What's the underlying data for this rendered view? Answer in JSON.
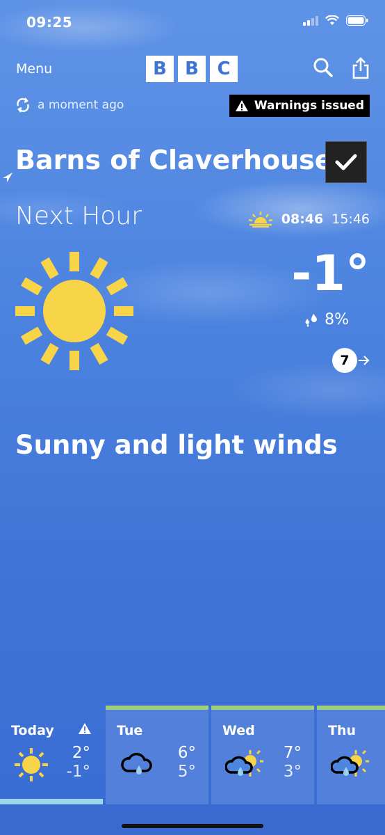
{
  "status_bar": {
    "time": "09:25"
  },
  "header": {
    "menu_label": "Menu",
    "logo_letters": [
      "B",
      "B",
      "C"
    ],
    "search_icon": "search-icon",
    "share_icon": "share-icon"
  },
  "update": {
    "text": "a moment ago"
  },
  "warning": {
    "label": "Warnings issued"
  },
  "location": {
    "name": "Barns of Claverhouse"
  },
  "current": {
    "period": "Next Hour",
    "sunrise": "08:46",
    "sunset": "15:46",
    "temperature": "-1°",
    "precipitation": "8%",
    "wind_speed": "7",
    "summary": "Sunny and light winds"
  },
  "forecast": [
    {
      "day": "Today",
      "high": "2°",
      "low": "-1°",
      "icon": "sun-icon",
      "warning": true
    },
    {
      "day": "Tue",
      "high": "6°",
      "low": "5°",
      "icon": "cloud-rain-icon",
      "warning": false
    },
    {
      "day": "Wed",
      "high": "7°",
      "low": "3°",
      "icon": "sun-cloud-rain-icon",
      "warning": false
    },
    {
      "day": "Thu",
      "high": "",
      "low": "",
      "icon": "sun-cloud-rain-icon",
      "warning": false
    }
  ],
  "colors": {
    "sun": "#f8d548",
    "warning_bg": "#000000",
    "accent_bar": "#9fd17a"
  }
}
